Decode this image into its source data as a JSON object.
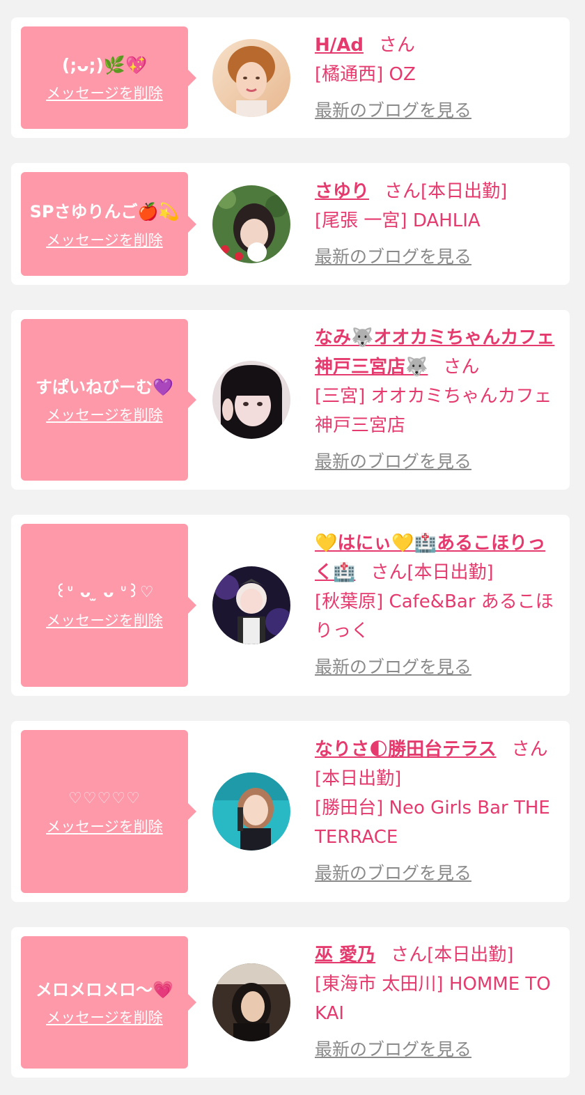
{
  "colors": {
    "background": "#f2f2f2",
    "card": "#ffffff",
    "bubble": "#fe99a9",
    "accent": "#e53a6e",
    "link_gray": "#8a8a8a"
  },
  "labels": {
    "delete": "メッセージを削除",
    "blog": "最新のブログを見る",
    "san": "さん"
  },
  "entries": [
    {
      "message": "(;ᴗ;)🌿💖",
      "name": "H/Ad",
      "suffix": "さん",
      "shop": "[橘通西] OZ",
      "avatar": "avatar-photo"
    },
    {
      "message": "SPさゆりんご🍎💫",
      "name": "さゆり",
      "suffix": "さん[本日出勤]",
      "shop": "[尾張 一宮] DAHLIA",
      "avatar": "avatar-photo"
    },
    {
      "message": "すぱいねびーむ💜",
      "name": "なみ🐺オオカミちゃんカフェ神戸三宮店🐺",
      "suffix": "さん",
      "shop": "[三宮] オオカミちゃんカフェ神戸三宮店",
      "avatar": "avatar-photo"
    },
    {
      "message": "꒰ᐡ ᴗ ̫ ᴗ ᐡ꒱♡",
      "name": "💛はにぃ💛🏥あるこほりっく🏥",
      "suffix": "さん[本日出勤]",
      "shop": "[秋葉原] Cafe&Bar あるこほりっく",
      "avatar": "avatar-photo"
    },
    {
      "message": "♡♡♡♡♡",
      "name": "なりさ🌓勝田台テラス",
      "suffix": "さん[本日出勤]",
      "shop": "[勝田台] Neo Girls Bar THE TERRACE",
      "avatar": "avatar-photo"
    },
    {
      "message": "メロメロメロ〜💗",
      "name": "巫 愛乃",
      "suffix": "さん[本日出勤]",
      "shop": "[東海市 太田川] HOMME TOKAI",
      "avatar": "avatar-photo"
    }
  ]
}
